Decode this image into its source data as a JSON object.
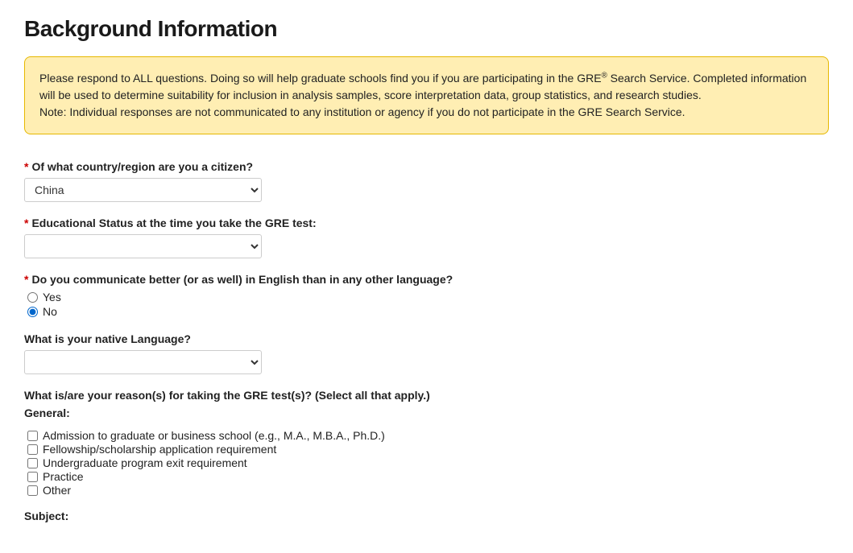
{
  "header": {
    "title": "Background Information"
  },
  "infoBox": {
    "line1_pre": "Please respond to ALL questions. Doing so will help graduate schools find you if you are participating in the GRE",
    "line1_sup": "®",
    "line1_post": " Search Service. Completed information will be used to determine suitability for inclusion in analysis samples, score interpretation data, group statistics, and research studies.",
    "line2": "Note: Individual responses are not communicated to any institution or agency if you do not participate in the GRE Search Service."
  },
  "fields": {
    "country": {
      "required": "*",
      "label": "Of what country/region are you a citizen?",
      "value": "China"
    },
    "eduStatus": {
      "required": "*",
      "label": "Educational Status at the time you take the GRE test:",
      "value": ""
    },
    "englishComm": {
      "required": "*",
      "label": "Do you communicate better (or as well) in English than in any other language?",
      "options": {
        "yes": "Yes",
        "no": "No"
      },
      "selected": "no"
    },
    "nativeLang": {
      "label": "What is your native Language?",
      "value": ""
    },
    "reasons": {
      "label": "What is/are your reason(s) for taking the GRE test(s)? (Select all that apply.)",
      "generalLabel": "General:",
      "subjectLabel": "Subject:",
      "items": [
        "Admission to graduate or business school (e.g., M.A., M.B.A., Ph.D.)",
        "Fellowship/scholarship application requirement",
        "Undergraduate program exit requirement",
        "Practice",
        "Other"
      ]
    }
  }
}
